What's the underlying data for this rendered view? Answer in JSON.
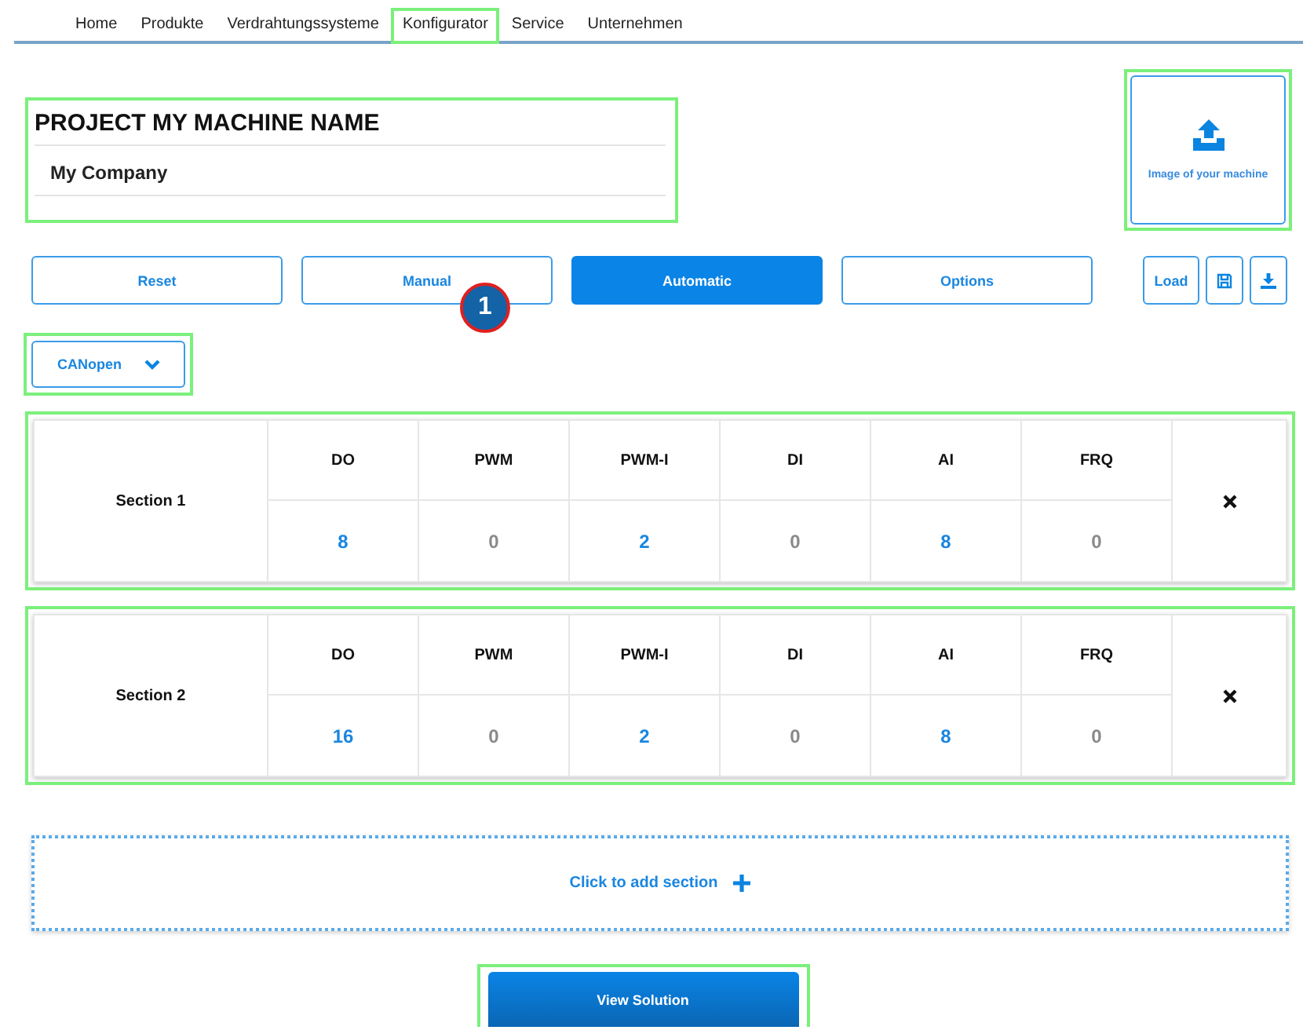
{
  "nav": [
    {
      "label": "Home",
      "highlighted": false
    },
    {
      "label": "Produkte",
      "highlighted": false
    },
    {
      "label": "Verdrahtungssysteme",
      "highlighted": false
    },
    {
      "label": "Konfigurator",
      "highlighted": true
    },
    {
      "label": "Service",
      "highlighted": false
    },
    {
      "label": "Unternehmen",
      "highlighted": false
    }
  ],
  "project": {
    "title": "PROJECT MY MACHINE NAME",
    "company": "My Company"
  },
  "image_upload": {
    "label": "Image of your machine"
  },
  "action_buttons": [
    {
      "label": "Reset",
      "selected": false
    },
    {
      "label": "Manual",
      "selected": false
    },
    {
      "label": "Automatic",
      "selected": true
    },
    {
      "label": "Options",
      "selected": false
    }
  ],
  "file_buttons": {
    "load": "Load"
  },
  "step_marker": "1",
  "protocol_dropdown": {
    "value": "CANopen"
  },
  "sections": [
    {
      "name": "Section 1",
      "columns": [
        "DO",
        "PWM",
        "PWM-I",
        "DI",
        "AI",
        "FRQ"
      ],
      "values": [
        "8",
        "0",
        "2",
        "0",
        "8",
        "0"
      ]
    },
    {
      "name": "Section 2",
      "columns": [
        "DO",
        "PWM",
        "PWM-I",
        "DI",
        "AI",
        "FRQ"
      ],
      "values": [
        "16",
        "0",
        "2",
        "0",
        "8",
        "0"
      ]
    }
  ],
  "add_section": {
    "label": "Click to add section"
  },
  "view_solution": {
    "label": "View Solution"
  }
}
